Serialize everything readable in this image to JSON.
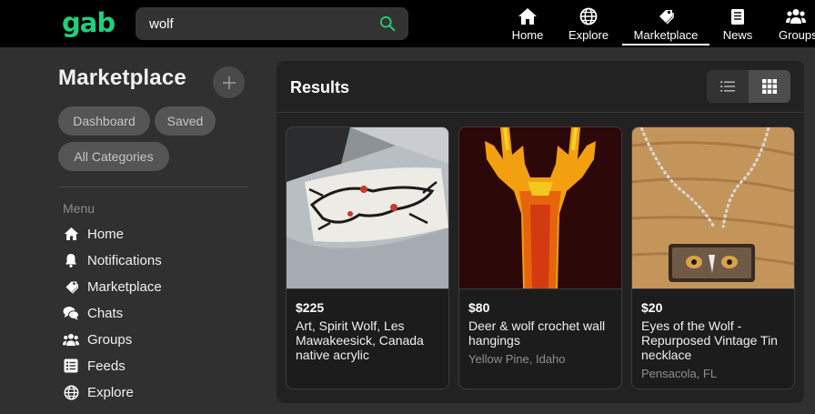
{
  "app": {
    "logo": "gab"
  },
  "search": {
    "value": "wolf",
    "icon": "search-icon"
  },
  "nav": [
    {
      "label": "Home",
      "icon": "home-icon"
    },
    {
      "label": "Explore",
      "icon": "globe-icon"
    },
    {
      "label": "Marketplace",
      "icon": "tag-icon",
      "active": true
    },
    {
      "label": "News",
      "icon": "newspaper-icon"
    },
    {
      "label": "Groups",
      "icon": "groups-icon"
    }
  ],
  "sidebar": {
    "title": "Marketplace",
    "add_icon": "plus-icon",
    "pills": {
      "dashboard": "Dashboard",
      "saved": "Saved",
      "all_categories": "All Categories"
    },
    "menu_label": "Menu",
    "menu": [
      {
        "label": "Home",
        "icon": "home-icon"
      },
      {
        "label": "Notifications",
        "icon": "bell-icon"
      },
      {
        "label": "Marketplace",
        "icon": "tag-icon"
      },
      {
        "label": "Chats",
        "icon": "chat-icon"
      },
      {
        "label": "Groups",
        "icon": "groups-icon"
      },
      {
        "label": "Feeds",
        "icon": "feeds-icon"
      },
      {
        "label": "Explore",
        "icon": "globe-icon"
      }
    ]
  },
  "results": {
    "title": "Results",
    "view_toggle": {
      "list_icon": "list-view-icon",
      "grid_icon": "grid-view-icon",
      "selected": "grid"
    },
    "cards": [
      {
        "price": "$225",
        "title": "Art, Spirit Wolf, Les Mawakeesick, Canada native acrylic",
        "location": "",
        "image": "spirit-wolf-painting"
      },
      {
        "price": "$80",
        "title": "Deer & wolf crochet wall hangings",
        "location": "Yellow Pine, Idaho",
        "image": "crochet-deer"
      },
      {
        "price": "$20",
        "title": "Eyes of the Wolf - Repurposed Vintage Tin necklace",
        "location": "Pensacola, FL",
        "image": "wolf-necklace"
      }
    ]
  },
  "colors": {
    "brand": "#21cf7a",
    "background": "#303030",
    "panel": "#222222",
    "topbar": "#000000"
  }
}
